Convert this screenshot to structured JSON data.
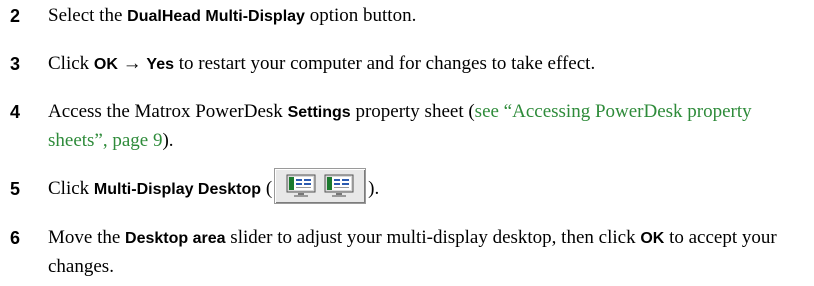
{
  "steps": [
    {
      "num": "2",
      "p1": "Select the ",
      "b1": "DualHead Multi-Display",
      "p2": " option button."
    },
    {
      "num": "3",
      "p1": "Click ",
      "b1": "OK",
      "arrow": " → ",
      "b2": "Yes",
      "p2": " to restart your computer and for changes to take effect."
    },
    {
      "num": "4",
      "p1": "Access the Matrox PowerDesk ",
      "b1": "Settings",
      "p2": " property sheet (",
      "link": "see “Accessing PowerDesk property sheets”, page 9",
      "p3": ")."
    },
    {
      "num": "5",
      "p1": "Click ",
      "b1": "Multi-Display Desktop",
      "p2": " (",
      "icon": "multi-display-desktop-icon",
      "p3": ")."
    },
    {
      "num": "6",
      "p1": "Move the ",
      "b1": "Desktop area",
      "p2": " slider to adjust your multi-display desktop, then click ",
      "b2": "OK",
      "p3": " to accept your changes."
    }
  ],
  "colors": {
    "link": "#2e8b3a",
    "text": "#000000"
  }
}
